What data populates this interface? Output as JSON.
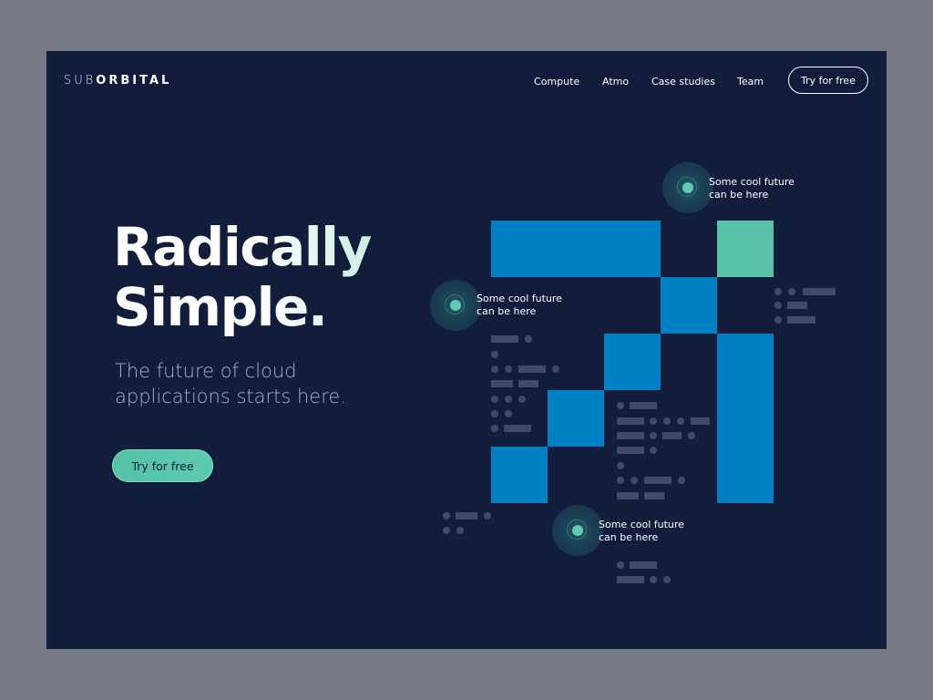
{
  "header": {
    "logo_light": "SUB",
    "logo_bold": "ORBITAL",
    "nav": [
      "Compute",
      "Atmo",
      "Case studies",
      "Team"
    ],
    "cta": "Try for free"
  },
  "hero": {
    "headline_line1": "Radically",
    "headline_line2": "Simple.",
    "subline": "The future of cloud applications starts here.",
    "cta": "Try for free"
  },
  "callouts": [
    {
      "line1": "Some cool future",
      "line2": "can be here"
    },
    {
      "line1": "Some cool future",
      "line2": "can be here"
    },
    {
      "line1": "Some cool future",
      "line2": "can be here"
    }
  ],
  "colors": {
    "background": "#121d3c",
    "frame_outer": "#767a85",
    "block_blue": "#0080c4",
    "block_teal": "#5ac2a7",
    "accent_teal": "#5ccbb0",
    "decor_gray": "#3e4a66"
  }
}
